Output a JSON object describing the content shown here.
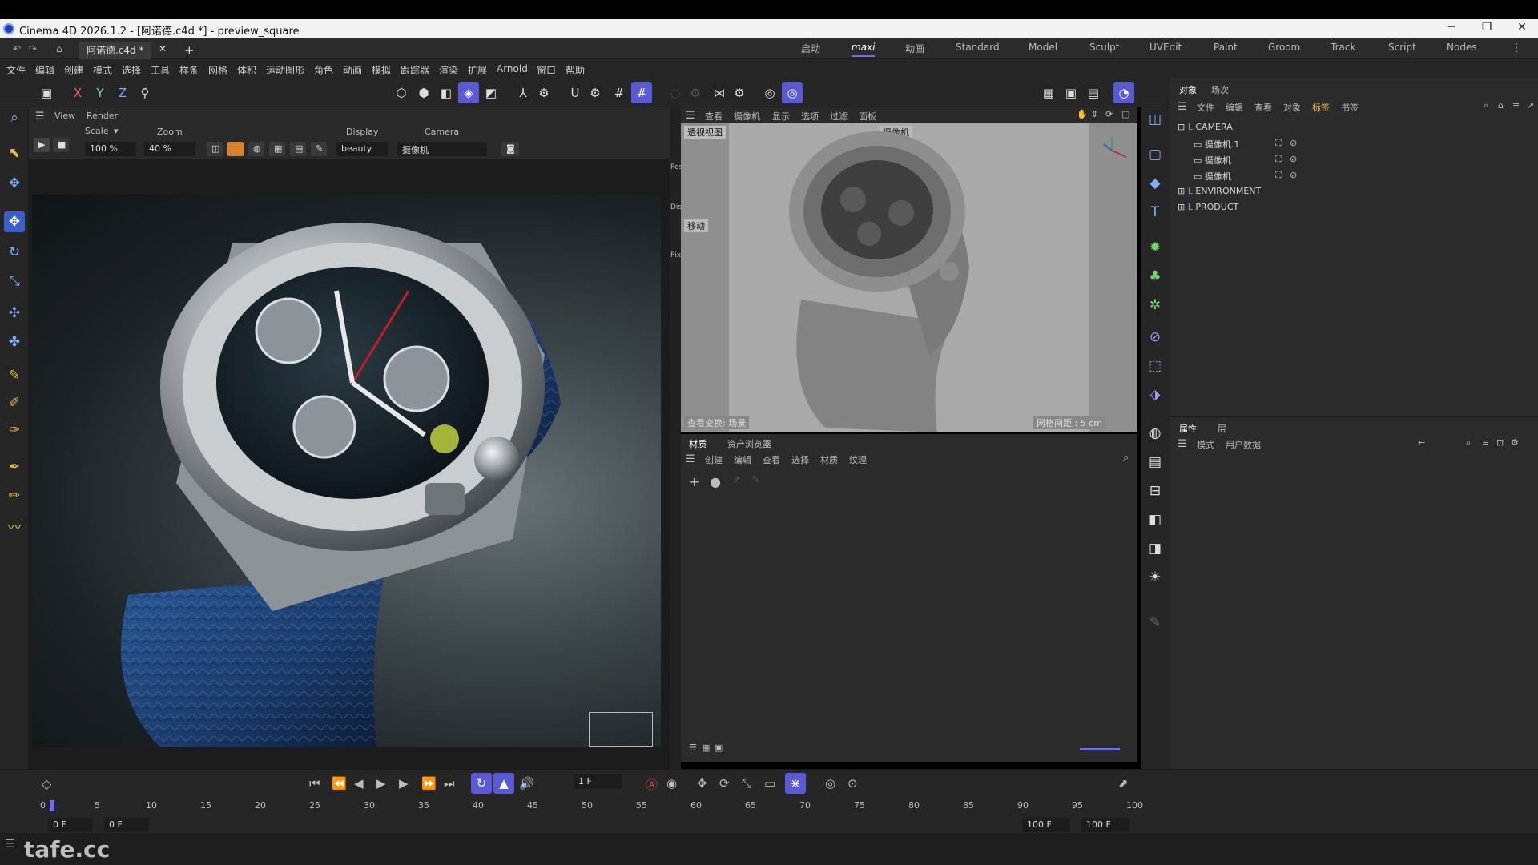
{
  "window": {
    "title": "Cinema 4D 2026.1.2 - [阿诺德.c4d *] - preview_square",
    "minimize": "─",
    "maximize": "❐",
    "close": "✕"
  },
  "tabs": {
    "doc_tab": "阿诺德.c4d *",
    "close": "✕",
    "add": "+"
  },
  "layouts": [
    "启动",
    "maxi",
    "动画",
    "Standard",
    "Model",
    "Sculpt",
    "UVEdit",
    "Paint",
    "Groom",
    "Track",
    "Script",
    "Nodes"
  ],
  "menu": [
    "文件",
    "编辑",
    "创建",
    "模式",
    "选择",
    "工具",
    "样条",
    "网格",
    "体积",
    "运动图形",
    "角色",
    "动画",
    "模拟",
    "跟踪器",
    "渲染",
    "扩展",
    "Arnold",
    "窗口",
    "帮助"
  ],
  "axis": {
    "x": "X",
    "y": "Y",
    "z": "Z"
  },
  "viewport1": {
    "menu_view": "View",
    "menu_render": "Render",
    "scale_label": "Scale",
    "scale_value": "100 %",
    "zoom_label": "Zoom",
    "zoom_value": "40 %",
    "display_label": "Display",
    "display_value": "beauty",
    "camera_label": "Camera",
    "camera_value": "摄像机",
    "side_tabs": [
      "Post",
      "Display",
      "Pixel"
    ]
  },
  "viewport2": {
    "menu": [
      "查看",
      "摄像机",
      "显示",
      "选项",
      "过滤",
      "面板"
    ],
    "view_label": "透视视图",
    "camera_tag": "摄像机",
    "move_label": "移动",
    "view_transform": "查看变换: 场景",
    "grid_spacing": "网格间距 : 5 cm"
  },
  "material_panel": {
    "tabs": [
      "材质",
      "资产浏览器"
    ],
    "menu": [
      "创建",
      "编辑",
      "查看",
      "选择",
      "材质",
      "纹理"
    ]
  },
  "object_panel": {
    "tabs": [
      "对象",
      "场次"
    ],
    "menu": [
      "文件",
      "编辑",
      "查看",
      "对象",
      "标签",
      "书签"
    ],
    "tree": [
      {
        "name": "CAMERA",
        "level": 0
      },
      {
        "name": "摄像机.1",
        "level": 1
      },
      {
        "name": "摄像机",
        "level": 1
      },
      {
        "name": "摄像机",
        "level": 1
      },
      {
        "name": "ENVIRONMENT",
        "level": 0
      },
      {
        "name": "PRODUCT",
        "level": 0
      }
    ]
  },
  "attribute_panel": {
    "tabs": [
      "属性",
      "层"
    ],
    "menu": [
      "模式",
      "用户数据"
    ]
  },
  "timeline": {
    "current_frame": "1 F",
    "ticks": [
      "0",
      "5",
      "10",
      "15",
      "20",
      "25",
      "30",
      "35",
      "40",
      "45",
      "50",
      "55",
      "60",
      "65",
      "70",
      "75",
      "80",
      "85",
      "90",
      "95",
      "100"
    ],
    "start_a": "0 F",
    "start_b": "0 F",
    "end_a": "100 F",
    "end_b": "100 F"
  },
  "watermark": "tafe.cc",
  "colors": {
    "accent": "#5a5ad6",
    "bg": "#2b2b2b",
    "watch_strap": "#1f3f73"
  }
}
